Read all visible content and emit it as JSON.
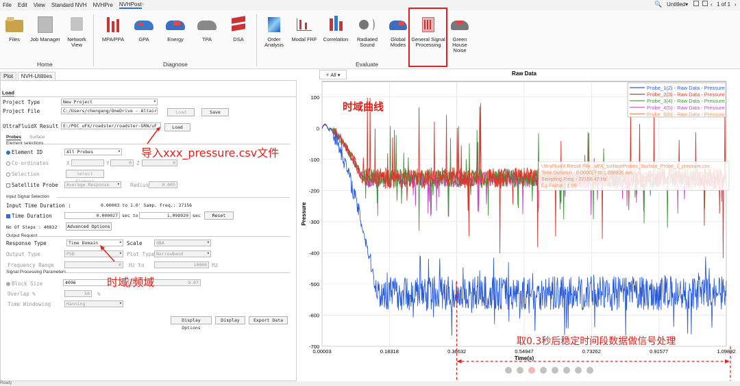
{
  "menu": [
    "File",
    "Edit",
    "View",
    "Standard NVH",
    "NVHPre",
    "NVHPost"
  ],
  "titlebar": {
    "doc": "Untitled▾",
    "pager": "1 of 1"
  },
  "ribbon": {
    "home": [
      {
        "label": "Files"
      },
      {
        "label": "Job Manager"
      },
      {
        "label": "Network View"
      }
    ],
    "diagnose": [
      {
        "label": "MPA/PPA"
      },
      {
        "label": "GPA"
      },
      {
        "label": "Energy"
      },
      {
        "label": "TPA"
      },
      {
        "label": "DSA"
      }
    ],
    "evaluate": [
      {
        "label": "Order Analysis"
      },
      {
        "label": "Modal FRF"
      },
      {
        "label": "Correlation"
      },
      {
        "label": "Radiated Sound"
      },
      {
        "label": "Global Modes"
      },
      {
        "label": "General Signal Processing"
      },
      {
        "label": "Green House Noise"
      }
    ],
    "groups": [
      "Home",
      "Diagnose",
      "Evaluate"
    ]
  },
  "left_tabs": [
    "Plot",
    "NVH-Utilities"
  ],
  "panel": {
    "load_tab": "Load",
    "project_type_label": "Project Type",
    "project_type": "New Project",
    "project_file_label": "Project File",
    "project_file": "C:/Users/chengang/OneDrive - Altair",
    "load_btn": "Load",
    "save_btn": "Save",
    "result_label": "UltraFluidX Result File",
    "result_file": "E:/POC_uFX/roadster/roadster-GRN/uF",
    "result_load": "Load",
    "sub_tabs": [
      "Probes",
      "Surface"
    ],
    "element_selections": "Element selections",
    "element_id": "Element ID",
    "element_id_value": "All Probes",
    "coords": "Co-ordinates",
    "x": "X",
    "y": "Y",
    "z": "Z",
    "coord_val": "0",
    "selection": "Selection",
    "select_element": "Select Element",
    "satellite": "Satellite Probe",
    "avg_resp": "Average Response",
    "radius": "Radius",
    "radius_val": "0.005",
    "input_signal": "Input Signal Selection",
    "input_dur_label": "Input Time Duration :",
    "input_dur_val": "0.00003 to 1.0' Samp. Freq.: 37156",
    "time_duration": "Time Duration",
    "td_from": "0.000027",
    "sec_to": "sec to",
    "td_to": "1.098920",
    "sec": "sec",
    "reset": "Reset",
    "no_steps": "No Of Steps : 40832",
    "adv_opt": "Advanced Options",
    "output_request": "Output Request",
    "response_type": "Response Type",
    "response_val": "Time Domain",
    "scale": "Scale",
    "scale_val": "dBA",
    "output_type": "Output Type",
    "output_val": "PSD",
    "plot_type": "Plot Type",
    "plot_type_val": "Narrowband",
    "freq_range": "Frequency Range",
    "freq_from": "0",
    "hz_to": "Hz to",
    "freq_to": "10000",
    "hz": "Hz",
    "sig_proc": "Signal Processing Parameters",
    "block_size": "Block Size",
    "block_val": "4096",
    "block_res": "9.07",
    "overlap": "Overlap %",
    "overlap_val": "50",
    "pct": "%",
    "windowing": "Time Windowing",
    "window_val": "Hanning",
    "display_options": "Display Options",
    "display": "Display",
    "export": "Export Data"
  },
  "annotations": {
    "import": "导入xxx_pressure.csv文件",
    "time_freq": "时域/频域",
    "curve": "时域曲线",
    "steady": "取0.3秒后稳定时间段数据做信号处理"
  },
  "plot_toolbar": {
    "all": "All"
  },
  "status": "Ready",
  "chart_data": {
    "type": "line",
    "title": "Raw Data",
    "xlabel": "Time(s)",
    "ylabel": "Pressure",
    "xlim": [
      3e-05,
      1.09892
    ],
    "ylim": [
      -700,
      150
    ],
    "xticks": [
      "0.00003",
      "0.18318",
      "0.36632",
      "0.54947",
      "0.73262",
      "0.91577",
      "1.09892"
    ],
    "yticks": [
      "100",
      "0",
      "-100",
      "-200",
      "-300",
      "-400",
      "-500",
      "-600",
      "-700"
    ],
    "legend_position": "top-right",
    "series": [
      {
        "name": "Probe_1(2) - Raw Data - Pressure",
        "color": "#2a5bd7",
        "steady_mean": -530,
        "steady_amp": 55
      },
      {
        "name": "Probe_2(3) - Raw Data - Pressure",
        "color": "#d9372b",
        "steady_mean": -160,
        "steady_amp": 35
      },
      {
        "name": "Probe_3(4) - Raw Data - Pressure",
        "color": "#3c9a3c",
        "steady_mean": -160,
        "steady_amp": 30
      },
      {
        "name": "Probe_4(5) - Raw Data - Pressure",
        "color": "#c548c8",
        "steady_mean": -165,
        "steady_amp": 25
      },
      {
        "name": "Probe_5(6) - Raw Data - Pressure",
        "color": "#f29060",
        "steady_mean": -155,
        "steady_amp": 20
      }
    ],
    "tooltip": [
      "UltraFluidX Result File : uFX_surfaceProbes_Surface_Probe_1_pressure.csv",
      "Time Duration : 0.000027 to 1.098920 sec",
      "Sampling Freq. : 37158.47 Hz",
      "Cp Factor : 1.00"
    ]
  }
}
